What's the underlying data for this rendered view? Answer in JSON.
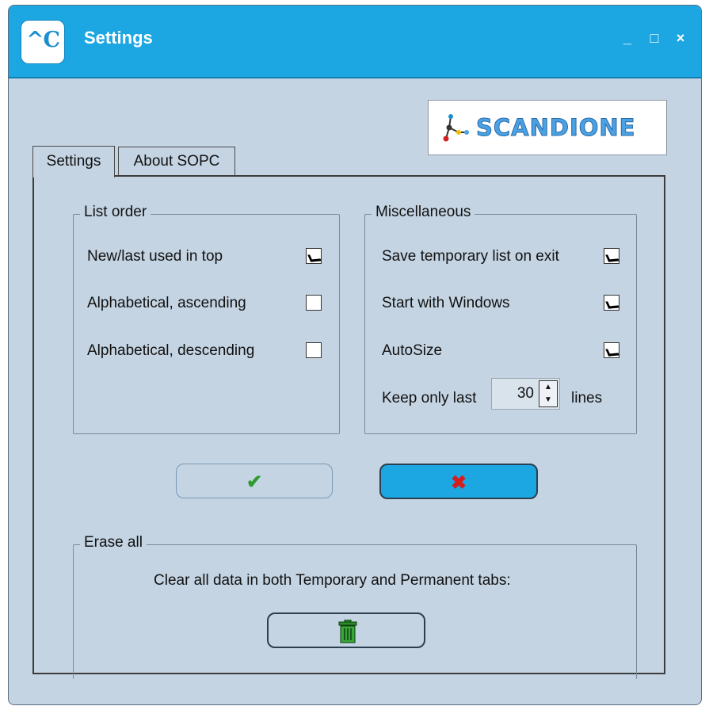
{
  "window": {
    "title": "Settings",
    "app_icon_text": "^C",
    "controls": [
      "_",
      "□",
      "×"
    ]
  },
  "logo": {
    "text": "SCANDIONE"
  },
  "tabs": [
    {
      "label": "Settings",
      "active": true
    },
    {
      "label": "About SOPC",
      "active": false
    }
  ],
  "list_order": {
    "title": "List order",
    "options": [
      {
        "label": "New/last used in top",
        "checked": true
      },
      {
        "label": "Alphabetical, ascending",
        "checked": false
      },
      {
        "label": "Alphabetical, descending",
        "checked": false
      }
    ]
  },
  "misc": {
    "title": "Miscellaneous",
    "options": [
      {
        "label": "Save temporary list on exit",
        "checked": true
      },
      {
        "label": "Start with Windows",
        "checked": true
      },
      {
        "label": "AutoSize",
        "checked": true
      }
    ],
    "keep_label": "Keep only last",
    "keep_value": "30",
    "keep_unit": "lines"
  },
  "buttons": {
    "ok_icon": "check-icon",
    "cancel_icon": "x-icon"
  },
  "erase": {
    "title": "Erase all",
    "description": "Clear all data in both Temporary and Permanent tabs:",
    "icon": "trash-icon"
  },
  "colors": {
    "titlebar": "#1ca7e3",
    "background": "#c4d4e3",
    "accent_green": "#2f9a2f",
    "accent_red": "#d41e1e"
  }
}
